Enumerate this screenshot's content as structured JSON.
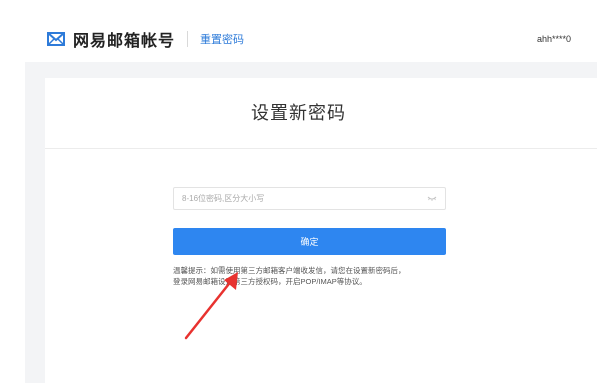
{
  "header": {
    "brand_title": "网易邮箱帐号",
    "section_link": "重置密码",
    "account": "ahh****0"
  },
  "card": {
    "title": "设置新密码",
    "password_placeholder": "8-16位密码,区分大小写",
    "confirm_label": "确定",
    "tip_line1": "温馨提示：如需使用第三方邮箱客户端收发信，请您在设置新密码后，",
    "tip_line2": "登录网易邮箱设置第三方授权码，开启POP/IMAP等协议。"
  },
  "colors": {
    "accent": "#2e86f0",
    "link": "#2e7bd9",
    "arrow": "#e8322f"
  },
  "icons": {
    "brand": "envelope-icon",
    "password_toggle": "eye-closed-icon",
    "annotation": "red-arrow"
  }
}
